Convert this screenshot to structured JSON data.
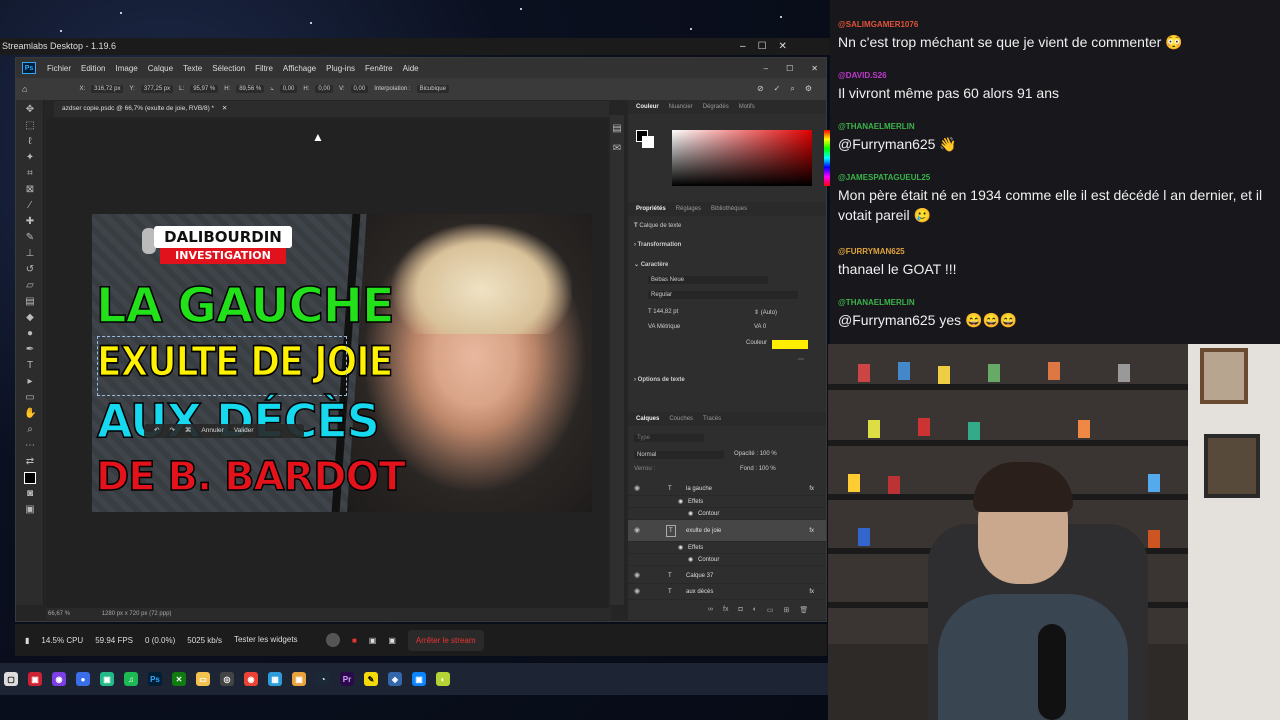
{
  "streamlabs": {
    "title": "Streamlabs Desktop - 1.19.6",
    "cpu": "14.5% CPU",
    "fps": "59.94 FPS",
    "dropped": "0 (0.0%)",
    "bitrate": "5025 kb/s",
    "test_widgets": "Tester les widgets",
    "stop_stream": "Arrêter le stream"
  },
  "ps": {
    "menu": [
      "Fichier",
      "Edition",
      "Image",
      "Calque",
      "Texte",
      "Sélection",
      "Filtre",
      "Affichage",
      "Plug-ins",
      "Fenêtre",
      "Aide"
    ],
    "opts": {
      "x": "316,72 px",
      "y": "377,25 px",
      "w": "95,97 %",
      "h": "89,56 %",
      "angle": "0,00",
      "h2": "0,00",
      "v": "0,00",
      "interp_label": "Interpolation :",
      "interp": "Bicubique"
    },
    "doc_tab": "azdser copie.psdc @ 66,7% (exulte de joie, RVB/8) *",
    "zoom": "66,67 %",
    "doc_size": "1280 px x 720 px (72 ppp)",
    "float_toolbar": {
      "cancel": "Annuler",
      "validate": "Valider"
    },
    "color_tabs": [
      "Couleur",
      "Nuancier",
      "Dégradés",
      "Motifs"
    ],
    "props_tabs": [
      "Propriétés",
      "Réglages",
      "Bibliothèques"
    ],
    "props": {
      "layer_type": "Calque de texte",
      "transform": "Transformation",
      "character": "Caractère",
      "font": "Bebas Neue",
      "style": "Regular",
      "size": "144,82 pt",
      "leading": "(Auto)",
      "kerning": "Métrique",
      "tracking": "0",
      "color_label": "Couleur",
      "text_options": "Options de texte"
    },
    "layers_tabs": [
      "Calques",
      "Couches",
      "Tracés"
    ],
    "layers_filter": "Type",
    "blend": "Normal",
    "opacity_label": "Opacité :",
    "opacity": "100 %",
    "fill_label": "Fond :",
    "fill": "100 %",
    "lock_label": "Verrou :",
    "layers": [
      {
        "name": "la gauche",
        "type": "text",
        "fx": true
      },
      {
        "name": "Effets",
        "type": "sub"
      },
      {
        "name": "Contour",
        "type": "sub2"
      },
      {
        "name": "exulte de joie",
        "type": "text",
        "fx": true,
        "selected": true
      },
      {
        "name": "Effets",
        "type": "sub"
      },
      {
        "name": "Contour",
        "type": "sub2"
      },
      {
        "name": "Calque 37",
        "type": "text"
      },
      {
        "name": "aux décès",
        "type": "text",
        "fx": true
      }
    ]
  },
  "thumbnail": {
    "logo_top": "DALIBOURDIN",
    "logo_bottom": "INVESTIGATION",
    "line1": "LA GAUCHE",
    "line2": "EXULTE DE JOIE",
    "line3": "AUX DÉCÈS",
    "line4": "DE B. BARDOT",
    "colors": {
      "line1": "#22e01a",
      "line2": "#fff200",
      "line3": "#16d8ee",
      "line4": "#e3121b"
    }
  },
  "chat": [
    {
      "user": "@SALIMGAMER1076",
      "color": "#e0533a",
      "text": "Nn c'est trop méchant se que je vient de commenter 😳"
    },
    {
      "user": "@DAVID.S26",
      "color": "#c23acf",
      "text": "Il vivront même pas 60 alors 91 ans"
    },
    {
      "user": "@THANAELMERLIN",
      "color": "#3bb44a",
      "text": "@Furryman625 👋"
    },
    {
      "user": "@JAMESPATAGUEUL25",
      "color": "#3bb44a",
      "text": "Mon père était né en 1934 comme elle il est décédé l an dernier, et il votait pareil 🥲"
    },
    {
      "user": "@FURRYMAN625",
      "color": "#e0a43a",
      "text": "thanael le GOAT !!!"
    },
    {
      "user": "@THANAELMERLIN",
      "color": "#3bb44a",
      "text": "@Furryman625 yes 😄😄😄"
    }
  ]
}
